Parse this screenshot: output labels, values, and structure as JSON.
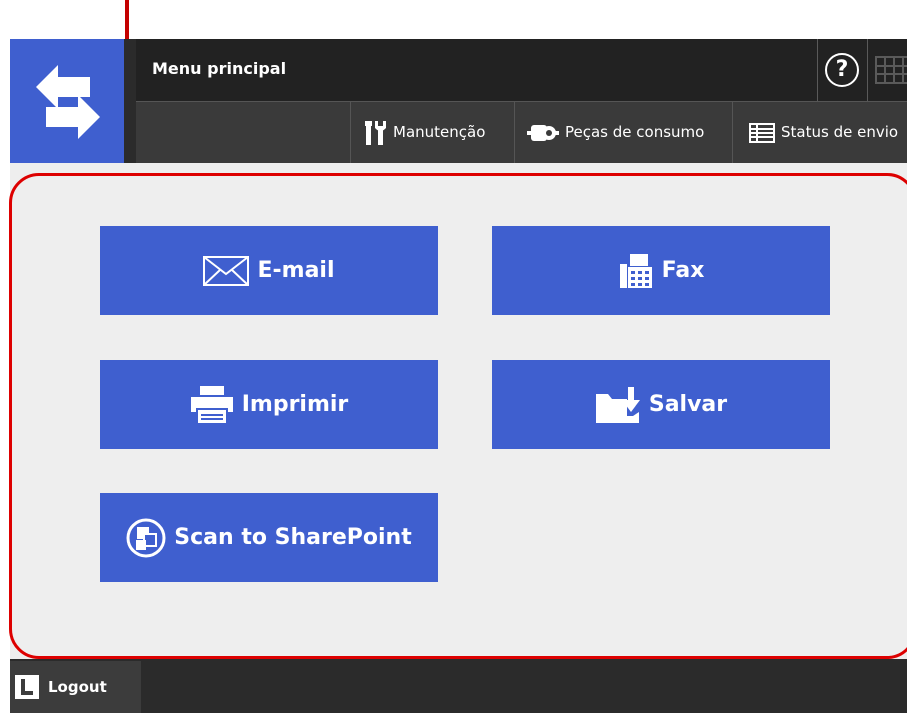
{
  "header": {
    "title": "Menu principal",
    "accent_color": "#3f5fcf",
    "logo_icon": "double-arrow-icon",
    "help_icon": "help-icon",
    "help_glyph": "?",
    "keyboard_icon": "keyboard-icon"
  },
  "toolbar": {
    "manutencao_label": "Manutenção",
    "pecas_label": "Peças de consumo",
    "status_label": "Status de envio"
  },
  "menu": {
    "email_label": "E-mail",
    "fax_label": "Fax",
    "imprimir_label": "Imprimir",
    "salvar_label": "Salvar",
    "scan_label": "Scan to SharePoint",
    "tile_color": "#3f5fcf"
  },
  "footer": {
    "logout_label": "Logout"
  },
  "annotation": {
    "outline_color": "#dd0000"
  }
}
